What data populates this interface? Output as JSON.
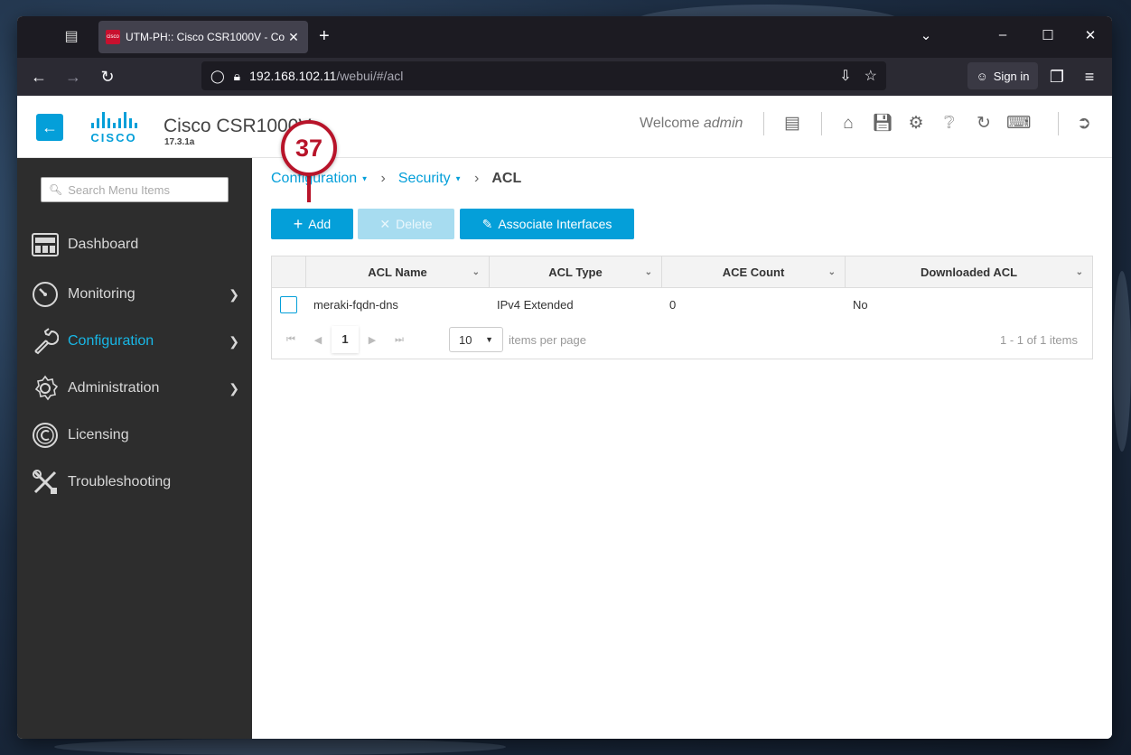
{
  "browser": {
    "tab_title": "UTM-PH:: Cisco CSR1000V - Co",
    "url_host": "192.168.102.11",
    "url_path": "/webui/#/acl",
    "sign_in_label": "Sign in"
  },
  "header": {
    "product_name": "Cisco CSR1000V",
    "version": "17.3.1a",
    "welcome_text": "Welcome",
    "user": "admin",
    "logo_text": "CISCO"
  },
  "sidebar": {
    "search_placeholder": "Search Menu Items",
    "items": [
      {
        "label": "Dashboard",
        "icon": "dashboard-icon"
      },
      {
        "label": "Monitoring",
        "icon": "gauge-icon"
      },
      {
        "label": "Configuration",
        "icon": "wrench-icon"
      },
      {
        "label": "Administration",
        "icon": "gear-icon"
      },
      {
        "label": "Licensing",
        "icon": "license-icon"
      },
      {
        "label": "Troubleshooting",
        "icon": "tools-icon"
      }
    ]
  },
  "breadcrumb": {
    "level1": "Configuration",
    "level2": "Security",
    "current": "ACL"
  },
  "toolbar": {
    "add_label": "Add",
    "delete_label": "Delete",
    "associate_label": "Associate Interfaces"
  },
  "grid": {
    "columns": [
      "ACL Name",
      "ACL Type",
      "ACE Count",
      "Downloaded ACL"
    ],
    "rows": [
      {
        "name": "meraki-fqdn-dns",
        "type": "IPv4 Extended",
        "ace_count": "0",
        "downloaded": "No"
      }
    ],
    "current_page": "1",
    "page_size": "10",
    "items_per_page_label": "items per page",
    "summary": "1 - 1 of 1 items"
  },
  "annotation": {
    "step_number": "37"
  },
  "colors": {
    "accent": "#049fd9",
    "sidebar_bg": "#2d2d2d",
    "active_item": "#18b7e6",
    "marker": "#b8142a"
  }
}
